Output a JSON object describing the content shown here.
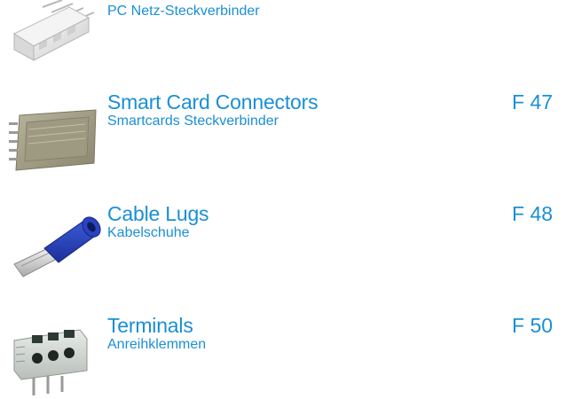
{
  "entries": [
    {
      "title": "",
      "subtitle": "PC Netz-Steckverbinder",
      "code": "",
      "image": "pc-header-connector-icon"
    },
    {
      "title": "Smart Card Connectors",
      "subtitle": "Smartcards Steckverbinder",
      "code": "F 47",
      "image": "smart-card-socket-icon"
    },
    {
      "title": "Cable Lugs",
      "subtitle": "Kabelschuhe",
      "code": "F 48",
      "image": "cable-lug-icon"
    },
    {
      "title": "Terminals",
      "subtitle": "Anreihklemmen",
      "code": "F 50",
      "image": "terminal-block-icon"
    }
  ],
  "colors": {
    "text": "#1a8fd6",
    "background": "#ffffff"
  }
}
